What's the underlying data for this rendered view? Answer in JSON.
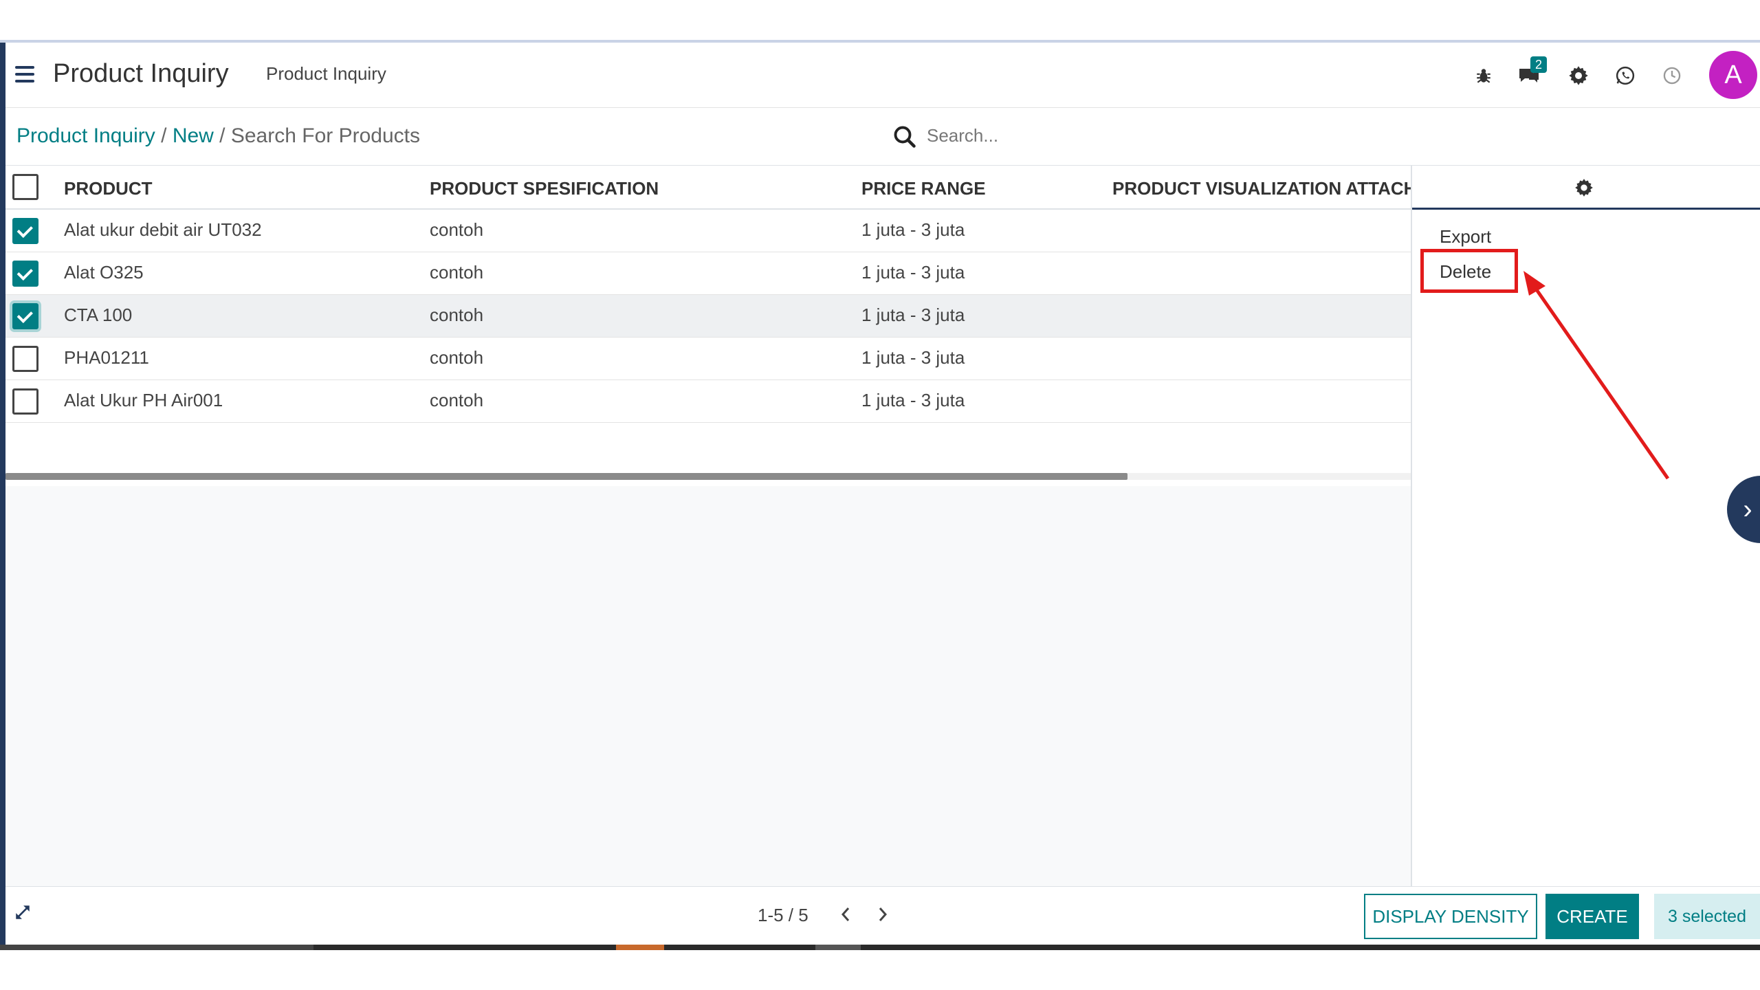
{
  "header": {
    "app_title": "Product Inquiry",
    "subtitle": "Product Inquiry",
    "messages_badge": "2",
    "avatar_letter": "A",
    "icons": [
      "bug-icon",
      "chat-icon",
      "settings-icon",
      "whatsapp-icon",
      "clock-icon"
    ]
  },
  "breadcrumb": {
    "items": [
      "Product Inquiry",
      "New"
    ],
    "separator": "/",
    "current": "Search For Products"
  },
  "search": {
    "placeholder": "Search..."
  },
  "table": {
    "columns": [
      "PRODUCT",
      "PRODUCT SPESIFICATION",
      "PRICE RANGE",
      "PRODUCT VISUALIZATION ATTACHMENT"
    ],
    "rows": [
      {
        "product": "Alat ukur debit air UT032",
        "spec": "contoh",
        "price": "1 juta - 3 juta",
        "checked": true
      },
      {
        "product": "Alat O325",
        "spec": "contoh",
        "price": "1 juta - 3 juta",
        "checked": true
      },
      {
        "product": "CTA 100",
        "spec": "contoh",
        "price": "1 juta - 3 juta",
        "checked": true
      },
      {
        "product": "PHA01211",
        "spec": "contoh",
        "price": "1 juta - 3 juta",
        "checked": false
      },
      {
        "product": "Alat Ukur PH Air001",
        "spec": "contoh",
        "price": "1 juta - 3 juta",
        "checked": false
      }
    ]
  },
  "actions_menu": {
    "items": [
      "Export",
      "Delete"
    ],
    "highlighted": "Delete"
  },
  "pager": {
    "value": "1-5 / 5"
  },
  "footer": {
    "display_density_label": "DISPLAY DENSITY",
    "create_label": "CREATE",
    "selected_label": "3 selected"
  },
  "colors": {
    "accent": "#017e84",
    "navy": "#23395d",
    "avatar": "#c321c2",
    "annotation": "#e21b1b"
  }
}
